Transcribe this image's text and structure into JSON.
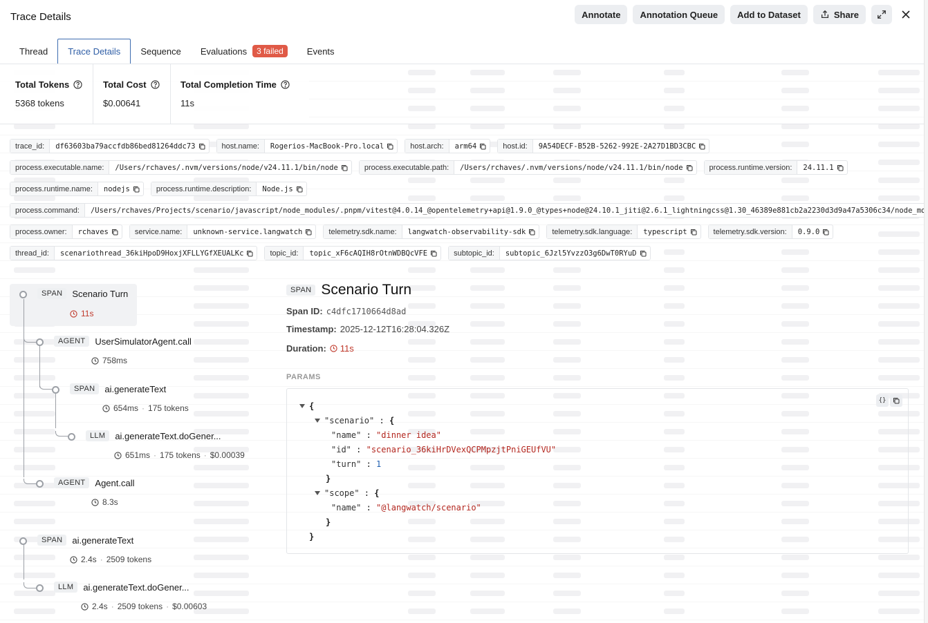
{
  "header": {
    "title": "Trace Details",
    "actions": {
      "annotate": "Annotate",
      "annotation_queue": "Annotation Queue",
      "add_to_dataset": "Add to Dataset",
      "share": "Share"
    }
  },
  "tabs": [
    {
      "label": "Thread"
    },
    {
      "label": "Trace Details"
    },
    {
      "label": "Sequence"
    },
    {
      "label": "Evaluations",
      "badge": "3 failed"
    },
    {
      "label": "Events"
    }
  ],
  "stats": {
    "total_tokens": {
      "label": "Total Tokens",
      "value": "5368 tokens"
    },
    "total_cost": {
      "label": "Total Cost",
      "value": "$0.00641"
    },
    "total_time": {
      "label": "Total Completion Time",
      "value": "11s"
    }
  },
  "attributes": [
    [
      {
        "key": "trace_id:",
        "value": "df63603ba79accfdb86bed81264ddc73"
      },
      {
        "key": "host.name:",
        "value": "Rogerios-MacBook-Pro.local"
      },
      {
        "key": "host.arch:",
        "value": "arm64"
      },
      {
        "key": "host.id:",
        "value": "9A54DECF-B52B-5262-992E-2A27D1BD3CBC"
      }
    ],
    [
      {
        "key": "process.executable.name:",
        "value": "/Users/rchaves/.nvm/versions/node/v24.11.1/bin/node"
      },
      {
        "key": "process.executable.path:",
        "value": "/Users/rchaves/.nvm/versions/node/v24.11.1/bin/node"
      },
      {
        "key": "process.runtime.version:",
        "value": "24.11.1"
      }
    ],
    [
      {
        "key": "process.runtime.name:",
        "value": "nodejs"
      },
      {
        "key": "process.runtime.description:",
        "value": "Node.js"
      }
    ],
    [
      {
        "key": "process.command:",
        "value": "/Users/rchaves/Projects/scenario/javascript/node_modules/.pnpm/vitest@4.0.14_@opentelemetry+api@1.9.0_@types+node@24.10.1_jiti@2.6.1_lightningcss@1.30_46389e881cb2a2230d3d9a47a5306c34/node_mo"
      }
    ],
    [
      {
        "key": "process.owner:",
        "value": "rchaves"
      },
      {
        "key": "service.name:",
        "value": "unknown-service.langwatch"
      },
      {
        "key": "telemetry.sdk.name:",
        "value": "langwatch-observability-sdk"
      },
      {
        "key": "telemetry.sdk.language:",
        "value": "typescript"
      },
      {
        "key": "telemetry.sdk.version:",
        "value": "0.9.0"
      }
    ],
    [
      {
        "key": "thread_id:",
        "value": "scenariothread_36kiHpoD9HoxjXFLLYGfXEUALKc"
      },
      {
        "key": "topic_id:",
        "value": "topic_xF6cAQIH8rOtnWDBQcVFE"
      },
      {
        "key": "subtopic_id:",
        "value": "subtopic_6Jzl5YvzzO3g6DwT0RYuD"
      }
    ]
  ],
  "tree": [
    {
      "kind": "SPAN",
      "name": "Scenario Turn",
      "duration": "11s",
      "tokens": "",
      "cost": ""
    },
    {
      "kind": "AGENT",
      "name": "UserSimulatorAgent.call",
      "duration": "758ms",
      "tokens": "",
      "cost": ""
    },
    {
      "kind": "SPAN",
      "name": "ai.generateText",
      "duration": "654ms",
      "tokens": "175 tokens",
      "cost": ""
    },
    {
      "kind": "LLM",
      "name": "ai.generateText.doGener...",
      "duration": "651ms",
      "tokens": "175 tokens",
      "cost": "$0.00039"
    },
    {
      "kind": "AGENT",
      "name": "Agent.call",
      "duration": "8.3s",
      "tokens": "",
      "cost": ""
    },
    {
      "kind": "SPAN",
      "name": "ai.generateText",
      "duration": "2.4s",
      "tokens": "2509 tokens",
      "cost": ""
    },
    {
      "kind": "LLM",
      "name": "ai.generateText.doGener...",
      "duration": "2.4s",
      "tokens": "2509 tokens",
      "cost": "$0.00603"
    }
  ],
  "detail": {
    "kind": "SPAN",
    "title": "Scenario Turn",
    "span_id_label": "Span ID:",
    "span_id": "c4dfc1710664d8ad",
    "timestamp_label": "Timestamp:",
    "timestamp": "2025-12-12T16:28:04.326Z",
    "duration_label": "Duration:",
    "duration": "11s",
    "params_label": "PARAMS",
    "json": {
      "open": "{",
      "scenario_key": "\"scenario\"",
      "name_key": "\"name\"",
      "name_val": "\"dinner idea\"",
      "id_key": "\"id\"",
      "id_val": "\"scenario_36kiHrDVexQCPMpzjtPniGEUfVU\"",
      "turn_key": "\"turn\"",
      "turn_val": "1",
      "scope_key": "\"scope\"",
      "scope_name_key": "\"name\"",
      "scope_name_val": "\"@langwatch/scenario\"",
      "close": "}"
    }
  }
}
